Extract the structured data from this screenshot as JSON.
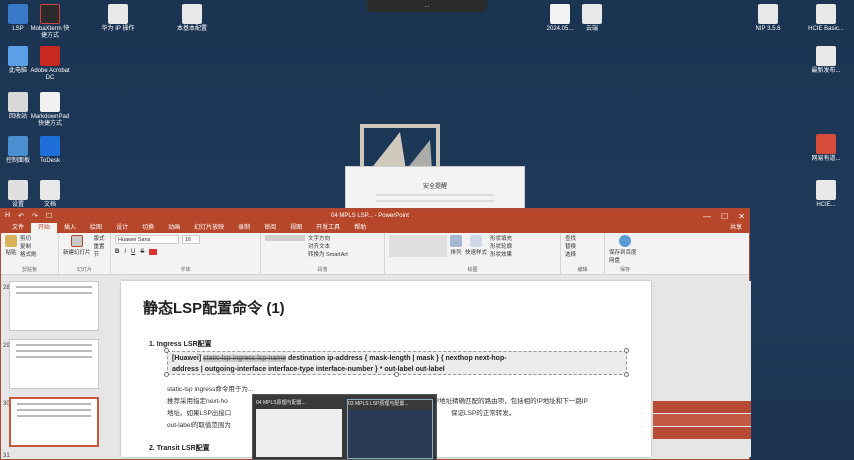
{
  "desktop": {
    "top_notice": "...",
    "icons": [
      {
        "label": "LSP"
      },
      {
        "label": "MobaXterm 快捷方式"
      },
      {
        "label": "华为 IP 操作"
      },
      {
        "label": "本基本配置"
      },
      {
        "label": "2024.05..."
      },
      {
        "label": "云端"
      },
      {
        "label": "NIP 3.5.6"
      },
      {
        "label": "HCIE Basic..."
      },
      {
        "label": "此电脑"
      },
      {
        "label": "Adobe Acrobat DC"
      },
      {
        "label": "最新发布..."
      },
      {
        "label": "回收站"
      },
      {
        "label": "MarkdownPad 快捷方式"
      },
      {
        "label": "控制面板"
      },
      {
        "label": "ToDesk"
      },
      {
        "label": "网易有道..."
      },
      {
        "label": "设置"
      },
      {
        "label": "文档"
      },
      {
        "label": "HCIE..."
      }
    ],
    "popup_title": "安全提醒"
  },
  "ppt": {
    "quick_access": [
      "H",
      "↶",
      "↷",
      "☐"
    ],
    "window_title": "04 MPLS LSP... - PowerPoint",
    "window_controls": [
      "—",
      "☐",
      "✕"
    ],
    "tabs": [
      "文件",
      "开始",
      "插入",
      "绘图",
      "设计",
      "切换",
      "动画",
      "幻灯片放映",
      "录制",
      "审阅",
      "视图",
      "开发工具",
      "帮助"
    ],
    "active_tab": "开始",
    "share": "共享",
    "ribbon": {
      "clipboard": {
        "paste": "粘贴",
        "cut": "剪切",
        "copy": "复制",
        "format": "格式刷",
        "label": "剪贴板"
      },
      "slides": {
        "new": "新建幻灯片",
        "layout": "版式",
        "reset": "重置",
        "section": "节",
        "label": "幻灯片"
      },
      "font": {
        "family": "Huawei Sans",
        "size": "16",
        "label": "字体",
        "bold": "B",
        "italic": "I",
        "underline": "U",
        "strike": "S"
      },
      "paragraph": {
        "direction": "文字方向",
        "align": "对齐文本",
        "smartart": "转换为 SmartArt",
        "label": "段落"
      },
      "drawing": {
        "arrange": "排列",
        "styles": "快速样式",
        "fill": "形状填充",
        "outline": "形状轮廓",
        "effects": "形状效果",
        "label": "绘图"
      },
      "editing": {
        "find": "查找",
        "replace": "替换",
        "select": "选择",
        "label": "编辑"
      },
      "save": {
        "save": "保存到百度网盘",
        "label": "保存"
      }
    },
    "thumbs": [
      {
        "num": "28"
      },
      {
        "num": "29"
      },
      {
        "num": "30"
      },
      {
        "num": "31"
      }
    ],
    "slide": {
      "title": "静态LSP配置命令 (1)",
      "section1": "1.   Ingress LSR配置",
      "cmd_prefix": "[Huawei]",
      "cmd_struck": "static-lsp ingress lsp-name",
      "cmd_line1_rest": " destination ip-address { mask-length | mask } { nexthop next-hop-",
      "cmd_line2": "address | outgoing-interface interface-type interface-number } * out-label out-label",
      "body1": "static-lsp ingress命令用于为...",
      "body2a": "推荐采用指定next-ho",
      "body2b": "IP地址精确匹配的路由项，包括相的IP地址和下一跳IP",
      "body3a": "地址。如果LSP出接口",
      "body3b": "保证LSP的正常转发。",
      "body4": "out-label的取值范围为",
      "section2": "2.   Transit LSR配置"
    }
  },
  "taskbar_preview": {
    "items": [
      {
        "label": "04 MPLS原理与配置..."
      },
      {
        "label": "03 MPLS LSP原理与配置..."
      }
    ]
  },
  "colors": {
    "accent": "#b7472a",
    "desktop_bg": "#1d3553"
  }
}
